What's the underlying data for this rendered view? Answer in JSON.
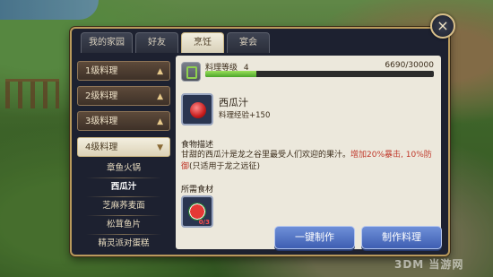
{
  "tabs": [
    {
      "label": "我的家园",
      "active": false
    },
    {
      "label": "好友",
      "active": false
    },
    {
      "label": "烹饪",
      "active": true
    },
    {
      "label": "宴会",
      "active": false
    }
  ],
  "sidebar": {
    "categories": [
      {
        "label": "1级料理",
        "open": false
      },
      {
        "label": "2级料理",
        "open": false
      },
      {
        "label": "3级料理",
        "open": false
      },
      {
        "label": "4级料理",
        "open": true
      }
    ],
    "recipes": [
      {
        "label": "章鱼火锅",
        "selected": false
      },
      {
        "label": "西瓜汁",
        "selected": true
      },
      {
        "label": "芝麻荞麦面",
        "selected": false
      },
      {
        "label": "松茸鱼片",
        "selected": false
      },
      {
        "label": "精灵派对蛋糕",
        "selected": false
      }
    ]
  },
  "level": {
    "label": "料理等级",
    "value": "4",
    "exp_text": "6690/30000",
    "progress": 0.223
  },
  "dish": {
    "name": "西瓜汁",
    "exp_label": "料理经验+150",
    "icon": "juice-cup-icon"
  },
  "description": {
    "title": "食物描述",
    "text_before": "甘甜的西瓜汁是龙之谷里最受人们欢迎的果汁。",
    "text_highlight": "增加20%暴击, 10%防御",
    "text_after": "(只适用于龙之远征)"
  },
  "ingredients": {
    "title": "所需食材",
    "items": [
      {
        "icon": "watermelon-icon",
        "count": "0/3"
      }
    ]
  },
  "buttons": {
    "one_click": "一键制作",
    "make": "制作料理"
  },
  "close_icon": "×",
  "watermark": "3DM 当游网",
  "colors": {
    "panel_border": "#b99a5c",
    "button_blue": "#3e5eb2",
    "progress_green": "#4aa52a",
    "highlight_red": "#c0392b"
  }
}
